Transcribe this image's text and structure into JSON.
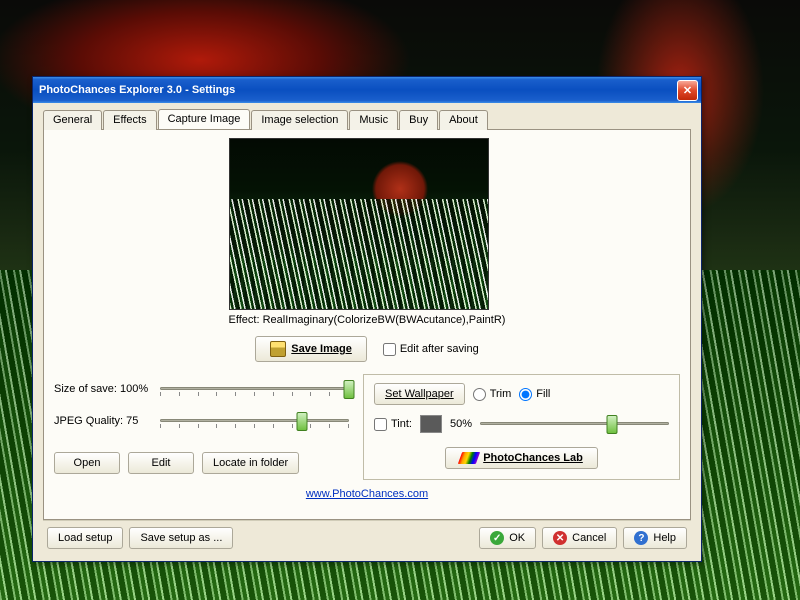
{
  "titlebar": {
    "title": "PhotoChances Explorer 3.0  -  Settings"
  },
  "tabs": {
    "items": [
      "General",
      "Effects",
      "Capture Image",
      "Image selection",
      "Music",
      "Buy",
      "About"
    ],
    "active_index": 2
  },
  "preview": {
    "effect_label": "Effect: RealImaginary(ColorizeBW(BWAcutance),PaintR)"
  },
  "save_row": {
    "save_label": "Save Image",
    "edit_after_saving_label": "Edit after saving",
    "edit_after_saving_checked": false
  },
  "sliders": {
    "size_label": "Size of save: 100%",
    "size_pct": 100,
    "jpeg_label": "JPEG Quality: 75",
    "jpeg_pct": 75
  },
  "left_buttons": {
    "open": "Open",
    "edit": "Edit",
    "locate": "Locate in folder"
  },
  "wallpaper": {
    "set_label": "Set Wallpaper",
    "trim_label": "Trim",
    "fill_label": "Fill",
    "selected": "fill",
    "tint_label": "Tint:",
    "tint_checked": false,
    "tint_value_label": "50%",
    "tint_pct": 70,
    "tint_color": "#5a5a5a",
    "lab_label": "PhotoChances Lab"
  },
  "link": {
    "text": "www.PhotoChances.com"
  },
  "bottom": {
    "load_setup": "Load setup",
    "save_setup": "Save setup as ...",
    "ok": "OK",
    "cancel": "Cancel",
    "help": "Help"
  }
}
